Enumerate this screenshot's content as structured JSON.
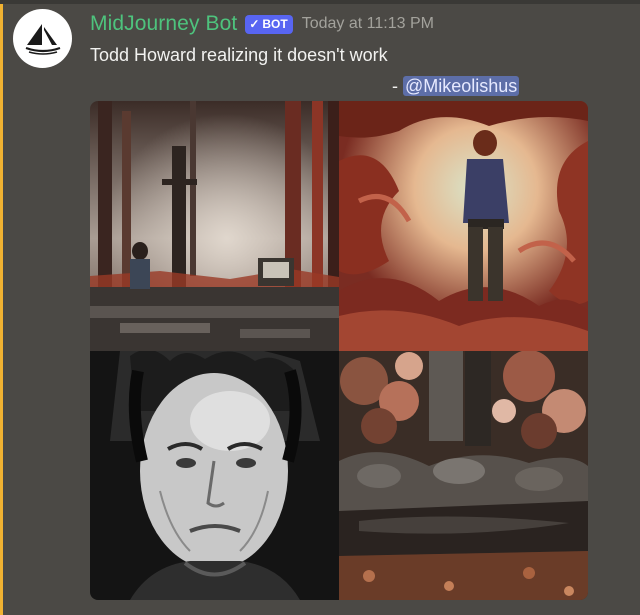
{
  "message": {
    "author": "MidJourney Bot",
    "badge": "BOT",
    "timestamp": "Today at 11:13 PM",
    "content": "Todd Howard realizing it doesn't work",
    "mention_prefix": "- ",
    "mention": "@Mikeolishus"
  },
  "avatar_icon": "sailboat-icon",
  "badge_icon": "checkmark-icon",
  "colors": {
    "author": "#4ec37d",
    "badge_bg": "#5865f2",
    "mention_bg": "#5d6ea8",
    "background": "#4b4945",
    "highlight": "#f0b232"
  }
}
